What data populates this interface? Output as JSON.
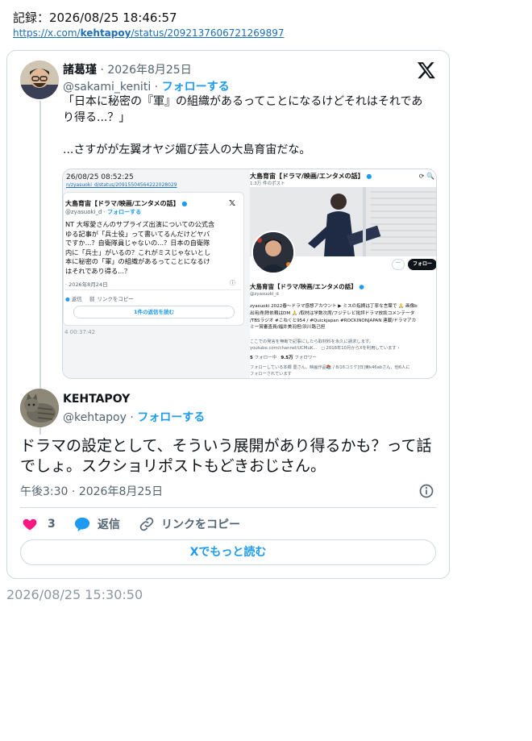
{
  "record": {
    "label": "記録：2026/08/25 18:46:57",
    "url_prefix": "https://x.com/",
    "url_user": "kehtapoy",
    "url_suffix": "/status/2092137606721269897"
  },
  "quoted_tweet": {
    "author_name": "諸葛瑾",
    "date": "2026年8月25日",
    "handle": "@sakami_keniti",
    "follow_label": "フォローする",
    "text_line1": "「日本に秘密の『軍』の組織があるってことになるけどそれはそれであり得る...？」",
    "text_line2": "...さすがが左翼オヤジ媚び芸人の大島育宙だな。"
  },
  "embedded_screenshot": {
    "left": {
      "timestamp": "26/08/25 08:52:25",
      "url": "n/zyasuoki_d/status/20915504564222028029",
      "name": "大島育宙【ドラマ/映画/エンタメの話】",
      "handle": "@zyasuoki_d",
      "follow": "フォローする",
      "text": "NT 大塚愛さんのサプライズ出演についての公式含\nゆる記事が「兵士役」って書いてるんだけどヤバ\nですか...？自衛隊員じゃないの...？日本の自衛隊\n内に「兵士」がいるの？これがミスじゃないとし\n本に秘密の「軍」の組織があるってことになるけ\nはそれであり得る...？",
      "date": "· 2026年8月24日",
      "reply": "返信",
      "copy_link": "リンクをコピー",
      "read_replies": "1件の返信を読む",
      "footer": "4 00:37:42"
    },
    "right": {
      "title": "大島育宙【ドラマ/映画/エンタメの話】",
      "posts": "1.3万 件のポスト",
      "follow": "フォロー",
      "name": "大島育宙【ドラマ/映画/エンタメの話】",
      "handle": "@zyasuoki_d",
      "bio": "zyasuoki 2022春〜ドラマ感想アカウント ▶ ミスの指摘は丁寧な言葉で 🙏 画像b\n出用/削除依頼はDM 🙏 /取材は学数次席/フジテレビ批評ドラマ放談コメンテータ\n/TBSラジオ #こねくと954 / #Quickjapan #ROCKINONJAPAN 連載/ドラマアカ\nミー賞審査員/福井美羽担/浜川路己担",
      "meta": "ここでの発言を無断で記事にしたら取材料を永久に請求します。\nyoutube.com/channel/UCMuK...   ◻ 2018年10月からXを利用しています ›",
      "following": "フォロー中",
      "followers_count": "9.5万",
      "followers": "フォロワー",
      "known": "フォローしている本郷 豊さん、映画作品📚 / 8/16コミケ[日]東k46abさん、他6人に\nフォローされています"
    }
  },
  "main_tweet": {
    "author_name": "KEHTAPOY",
    "handle": "@kehtapoy",
    "follow_label": "フォローする",
    "text": "ドラマの設定として、そういう展開があり得るかも？って話でしょ。スクショリポストもどきおじさん。",
    "time": "午後3:30",
    "date": "2026年8月25日",
    "like_count": "3",
    "reply_label": "返信",
    "copy_label": "リンクをコピー",
    "read_more": "Xでもっと読む"
  },
  "footer_timestamp": "2026/08/25 15:30:50",
  "colors": {
    "accent": "#1d9bf0",
    "like": "#f91880",
    "text": "#0f1419",
    "muted": "#536471",
    "border": "#cfd9de"
  },
  "icons": [
    "x-logo-icon",
    "info-icon",
    "heart-icon",
    "reply-bubble-icon",
    "link-icon"
  ]
}
